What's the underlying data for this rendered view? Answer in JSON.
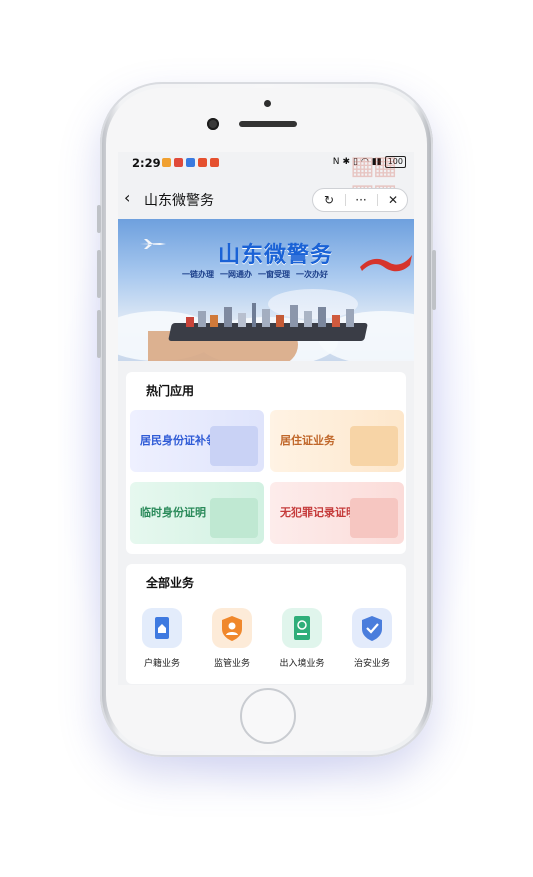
{
  "status": {
    "time": "2:29",
    "battery": "100"
  },
  "nav": {
    "title": "山东微警务",
    "more": "···",
    "close": "✕"
  },
  "banner": {
    "title": "山东微警务",
    "slogans": [
      "一链办理",
      "一网通办",
      "一窗受理",
      "一次办好"
    ]
  },
  "hot_apps": {
    "title": "热门应用",
    "items": [
      {
        "label": "居民身份证补领",
        "color": "#2f5bd6"
      },
      {
        "label": "居住证业务",
        "color": "#c0672a"
      },
      {
        "label": "临时身份证明",
        "color": "#2a8a5a"
      },
      {
        "label": "无犯罪记录证明",
        "color": "#c53b3b"
      }
    ]
  },
  "all_services": {
    "title": "全部业务",
    "items": [
      {
        "label": "户籍业务",
        "icon": "household-icon"
      },
      {
        "label": "监管业务",
        "icon": "shield-person-icon"
      },
      {
        "label": "出入境业务",
        "icon": "passport-icon"
      },
      {
        "label": "治安业务",
        "icon": "security-shield-icon"
      }
    ]
  }
}
